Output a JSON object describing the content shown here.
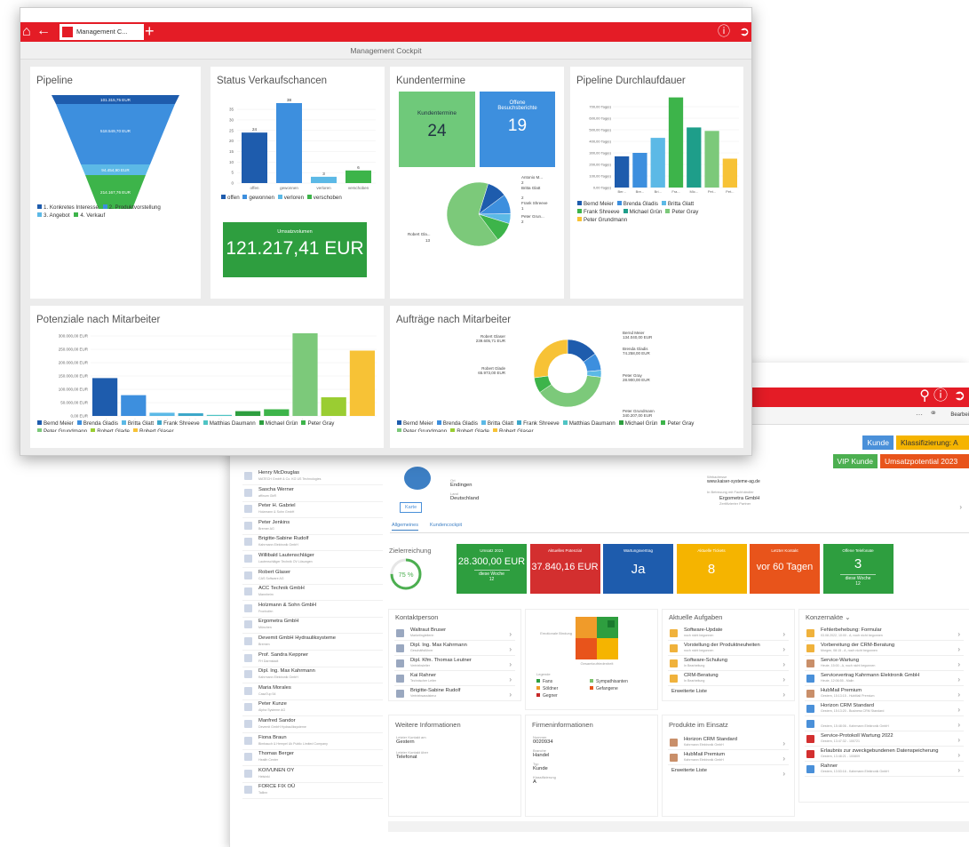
{
  "front": {
    "tab_title": "Management C...",
    "cockpit_title": "Management Cockpit",
    "pipeline": {
      "title": "Pipeline",
      "stages": [
        "101.315,75 EUR",
        "518.549,70 EUR",
        "94.454,90 EUR",
        "214.167,76 EUR"
      ],
      "legend": [
        "1. Konkretes Interesse",
        "2. Produktvorstellung",
        "3. Angebot",
        "4. Verkauf"
      ]
    },
    "status": {
      "title": "Status Verkaufschancen",
      "yticks": [
        "0",
        "5",
        "10",
        "15",
        "20",
        "25",
        "30",
        "35"
      ],
      "categories": [
        "offen",
        "gewonnen",
        "verloren",
        "verschoben"
      ],
      "values": [
        24,
        38,
        3,
        6
      ],
      "legend": [
        "offen",
        "gewonnen",
        "verloren",
        "verschoben"
      ]
    },
    "umsatz": {
      "label": "Umsatzvolumen",
      "value": "121.217,41 EUR"
    },
    "kundentermine": {
      "title": "Kundentermine",
      "tile1_label": "Kundentermine",
      "tile1_value": "24",
      "tile2_label": "Offene Besuchsberichte",
      "tile2_value": "19",
      "pie_labels": [
        "Antonio M...",
        "2",
        "Britta Glatt",
        "2",
        "Frank Shreeve",
        "1",
        "Peter Grun...",
        "2",
        "Robert Gla...",
        "13"
      ]
    },
    "durchlauf": {
      "title": "Pipeline Durchlaufdauer",
      "yticks": [
        "0,00 Tag(e)",
        "100,00 Tag(e)",
        "200,00 Tag(e)",
        "300,00 Tag(e)",
        "400,00 Tag(e)",
        "500,00 Tag(e)",
        "600,00 Tag(e)",
        "700,00 Tag(e)"
      ],
      "xticks": [
        "Ber...",
        "Bre...",
        "Bri...",
        "Fra...",
        "Mic...",
        "Pet...",
        "Pet..."
      ],
      "legend": [
        "Bernd Meier",
        "Brenda Gladis",
        "Britta Glatt",
        "Frank Shreeve",
        "Michael Grün",
        "Peter Gray",
        "Peter Grundmann"
      ]
    },
    "potenziale": {
      "title": "Potenziale nach Mitarbeiter",
      "yticks": [
        "0,00 EUR",
        "50.000,00 EUR",
        "100.000,00 EUR",
        "150.000,00 EUR",
        "200.000,00 EUR",
        "250.000,00 EUR",
        "300.000,00 EUR"
      ],
      "xticks": [
        "Bernd M...",
        "Brenda ...",
        "Britta Gl...",
        "Frank Sh...",
        "Matthia...",
        "Peter Gr...",
        "Peter Gr...",
        "Robert ...",
        "Robert ..."
      ],
      "legend": [
        "Bernd Meier",
        "Brenda Gladis",
        "Britta Glatt",
        "Frank Shreeve",
        "Matthias Daumann",
        "Michael Grün",
        "Peter Gray",
        "Peter Grundmann",
        "Robert Glade",
        "Robert Glaser"
      ]
    },
    "auftraege": {
      "title": "Aufträge nach Mitarbeiter",
      "labels": [
        "Robert Glaser",
        "239.605,71 EUR",
        "Robert Glade",
        "65.973,00 EUR",
        "Bernd Meier",
        "134.040,00 EUR",
        "Brenda Gladis",
        "74.258,00 EUR",
        "Peter Gray",
        "28.900,00 EUR",
        "Peter Grundmann",
        "340.207,00 EUR"
      ],
      "legend": [
        "Bernd Meier",
        "Brenda Gladis",
        "Britta Glatt",
        "Frank Shreeve",
        "Matthias Daumann",
        "Michael Grün",
        "Peter Gray",
        "Peter Grundmann",
        "Robert Glade",
        "Robert Glaser"
      ]
    }
  },
  "chart_data": [
    {
      "type": "bar",
      "title": "Status Verkaufschancen",
      "categories": [
        "offen",
        "gewonnen",
        "verloren",
        "verschoben"
      ],
      "values": [
        24,
        38,
        3,
        6
      ],
      "ylim": [
        0,
        38
      ]
    },
    {
      "type": "bar",
      "title": "Pipeline Durchlaufdauer",
      "categories": [
        "Bernd Meier",
        "Brenda Gladis",
        "Britta Glatt",
        "Frank Shreeve",
        "Michael Grün",
        "Peter Gray",
        "Peter Grundmann"
      ],
      "values": [
        270,
        300,
        430,
        780,
        520,
        490,
        250
      ],
      "ylim": [
        0,
        700
      ]
    },
    {
      "type": "bar",
      "title": "Potenziale nach Mitarbeiter",
      "categories": [
        "Bernd Meier",
        "Brenda Gladis",
        "Britta Glatt",
        "Frank Shreeve",
        "Matthias Daumann",
        "Michael Grün",
        "Peter Gray",
        "Peter Grundmann",
        "Robert Glade",
        "Robert Glaser"
      ],
      "values": [
        142000,
        78000,
        12000,
        10000,
        4000,
        18000,
        25000,
        350000,
        70000,
        245000
      ],
      "ylim": [
        0,
        300000
      ]
    },
    {
      "type": "pie",
      "title": "Kundentermine",
      "labels": [
        "Antonio M...",
        "Britta Glatt",
        "Frank Shreeve",
        "Peter Grun...",
        "Robert Gla..."
      ],
      "values": [
        2,
        2,
        1,
        2,
        13
      ]
    },
    {
      "type": "pie",
      "title": "Aufträge nach Mitarbeiter",
      "labels": [
        "Bernd Meier",
        "Brenda Gladis",
        "Peter Gray",
        "Peter Grundmann",
        "Robert Glade",
        "Robert Glaser"
      ],
      "values": [
        134040,
        74258,
        28900,
        340207,
        65973,
        239605.71
      ]
    }
  ],
  "back": {
    "toolbar": {
      "bearbeiten": "Bearbei"
    },
    "tags": [
      "Kunde",
      "Klassifizierung: A",
      "VIP Kunde",
      "Umsatzpotential 2023"
    ],
    "list": [
      [
        "Henry McDouglas",
        "MATECH GmbH & Co. KG US Technologies"
      ],
      [
        "Sascha Werner",
        "affinum GbR"
      ],
      [
        "Peter H. Gabriel",
        "Holzmann & Sohn GmbH"
      ],
      [
        "Peter Jenkins",
        "Bremer AG"
      ],
      [
        "Brigitte-Sabine Rudolf",
        "Kahrmann Elektronik GmbH"
      ],
      [
        "Willibald Lautenschläger",
        "Lautenschläger Technik OV Lösungen"
      ],
      [
        "Robert Glaser",
        "CAS Software AG"
      ],
      [
        "ACC Technik GmbH",
        "Mannheim"
      ],
      [
        "Holzmann & Sohn GmbH",
        "Fronhofen"
      ],
      [
        "Ergometra GmbH",
        "München"
      ],
      [
        "Devemit GmbH Hydrauliksysteme",
        "Bremen"
      ],
      [
        "Prof. Sandra Keppner",
        "FH Darmstadt"
      ],
      [
        "Dipl. Ing. Max Kahrmann",
        "Kahrmann Elektronik GmbH"
      ],
      [
        "Maria Morales",
        "CasaTup 54"
      ],
      [
        "Peter Kunze",
        "Alpha Systeme AG"
      ],
      [
        "Manfred Sandor",
        "Devemit GmbH Hydrauliksysteme"
      ],
      [
        "Fiona Braun",
        "Bimbauch & Hempel Uk Public Limited Company"
      ],
      [
        "Thomas Berger",
        "Health Center"
      ],
      [
        "KOIVUNEN OY",
        "Helsinki"
      ],
      [
        "FORCE FIX OÜ",
        "Tallinn"
      ]
    ],
    "address": {
      "ort_label": "Ort",
      "ort": "Endingen",
      "land_label": "Land",
      "land": "Deutschland",
      "web_label": "Webadresse",
      "web": "www.kaiser-systeme-ag.de",
      "betreuung_label": "In Betreuung mit Fachhändler",
      "betreuung": "Ergometra GmbH",
      "betreuung_sub": "Zertifizierter Partner",
      "karte": "Karte"
    },
    "tabs": [
      "Allgemeines",
      "Kundencockpit"
    ],
    "ziel": {
      "label": "Zielerreichung",
      "pct": "75 %"
    },
    "kpis": [
      {
        "label": "Umsatz 2021",
        "value": "28.300,00 EUR",
        "sub": "diese Woche",
        "sub2": "12"
      },
      {
        "label": "Aktuelles Potenzial",
        "value": "37.840,16 EUR",
        "sub": "",
        "sub2": ""
      },
      {
        "label": "Wartungsvertrag",
        "value": "Ja",
        "sub": "",
        "sub2": ""
      },
      {
        "label": "Aktuelle Tickets",
        "value": "8",
        "sub": "",
        "sub2": ""
      },
      {
        "label": "Letzter Kontakt",
        "value": "vor 60 Tagen",
        "sub": "",
        "sub2": ""
      },
      {
        "label": "Offene Telefonate",
        "value": "3",
        "sub": "diese Woche",
        "sub2": "12"
      }
    ],
    "kontakt": {
      "title": "Kontaktperson",
      "rows": [
        [
          "Waltraut Bruser",
          "Marketingleiterin"
        ],
        [
          "Dipl. Ing. Max Kahrmann",
          "Geschäftsführer"
        ],
        [
          "Dipl. Kfm. Thomas Leutner",
          "Vertriebsleiter"
        ],
        [
          "Kai Rahner",
          "Technischer Leiter"
        ],
        [
          "Brigitte-Sabine Rudolf",
          "Vertriebsassistenz"
        ]
      ]
    },
    "matrix": {
      "y": "Emotionale Bindung",
      "x": "Gesamtzufriedenheit",
      "legend_title": "Legende",
      "legend": [
        "Fans",
        "Sympathisanten",
        "Söldner",
        "Gefangene",
        "Gegner"
      ]
    },
    "aufgaben": {
      "title": "Aktuelle Aufgaben",
      "rows": [
        [
          "Software-Update",
          "noch nicht begonnen"
        ],
        [
          "Vorstellung der Produktneuheiten",
          "noch nicht begonnen"
        ],
        [
          "Software-Schulung",
          "In Bearbeitung"
        ],
        [
          "CRM-Beratung",
          "In Bearbeitung"
        ]
      ],
      "more": "Erweiterte Liste"
    },
    "konzern": {
      "title": "Konzernakte",
      "rows": [
        [
          "Fehlerbehebung: Formular",
          "03.08.2022, 10:00 - A, noch nicht begonnen"
        ],
        [
          "Vorbereitung der CRM-Beratung",
          "Morgen, 08:15 - A, noch nicht begonnen"
        ],
        [
          "Service-Wartung",
          "Heute, 15:00 - A, noch nicht begonnen"
        ],
        [
          "Servicevertrag Kahrmann Elektronik GmbH",
          "Heute, 12:06:55 - Malin"
        ],
        [
          "HubMail Premium",
          "Gestern, 15:13:15 - HubMail Premium"
        ],
        [
          "Horizon CRM Standard",
          "Gestern, 15:13:20 - Business CRM Standard"
        ],
        [
          "",
          "Gestern, 15:48:06 - Kahrmann Elektronik GmbH"
        ],
        [
          "Service-Protokoll Wartung 2022",
          "Gestern, 13:47:32 - 100721"
        ],
        [
          "Erlaubnis zur zweckgebundenen Datenspeicherung",
          "Gestern, 13:48:21 - 100809"
        ],
        [
          "Rahner",
          "Gestern, 13:53:16 - Kahrmann Elektronik GmbH"
        ]
      ]
    },
    "weitere": {
      "title": "Weitere Informationen",
      "l1": "Letzter Kontakt am",
      "v1": "Gestern",
      "l2": "Letzter Kontakt über",
      "v2": "Telefonat"
    },
    "firma": {
      "title": "Firmeninformationen",
      "l1": "Nummer",
      "v1": "0020934",
      "l2": "Branche",
      "v2": "Handel",
      "l3": "Typ",
      "v3": "Kunde",
      "l4": "Klassifizierung",
      "v4": "A"
    },
    "produkte": {
      "title": "Produkte im Einsatz",
      "rows": [
        [
          "Horizon CRM Standard",
          "Kahrmann Elektronik GmbH"
        ],
        [
          "HubMail Premium",
          "Kahrmann Elektronik GmbH"
        ]
      ],
      "more": "Erweiterte Liste"
    }
  }
}
